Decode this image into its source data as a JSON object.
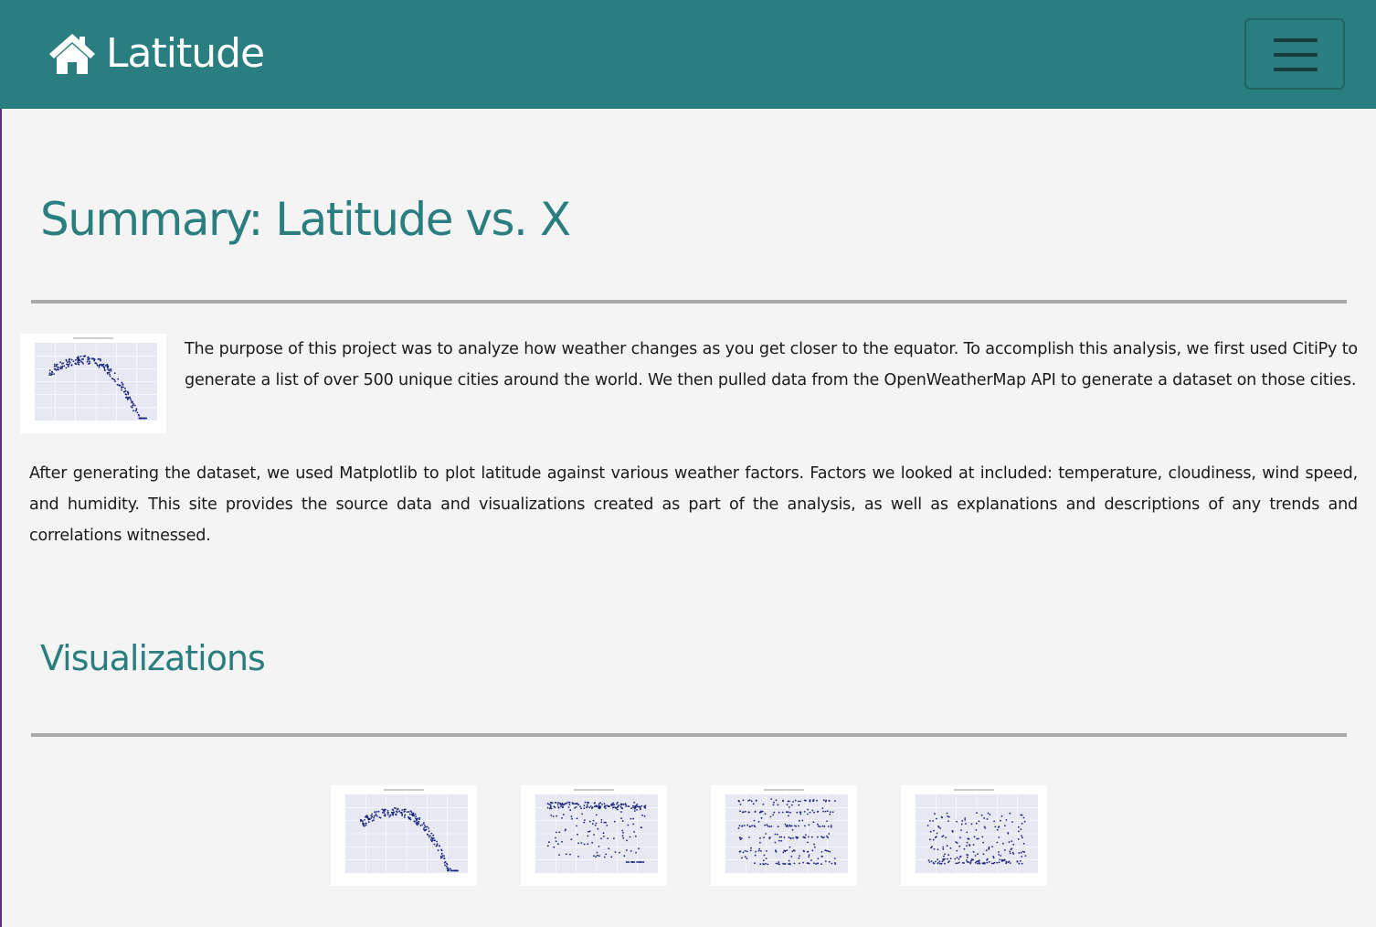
{
  "navbar": {
    "brand_icon": "home-icon",
    "brand_text": "Latitude",
    "menu_icon": "hamburger-menu-icon",
    "background_color": "#2b7e7f"
  },
  "main": {
    "title": "Summary: Latitude vs. X",
    "intro_paragraph": "The purpose of this project was to analyze how weather changes as you get closer to the equator. To accomplish this analysis, we first used CitiPy to generate a list of over 500 unique cities around the world. We then pulled data from the OpenWeatherMap API to generate a dataset on those cities.",
    "second_paragraph": "After generating the dataset, we used Matplotlib to plot latitude against various weather factors. Factors we looked at included: temperature, cloudiness, wind speed, and humidity. This site provides the source data and visualizations created as part of the analysis, as well as explanations and descriptions of any trends and correlations witnessed.",
    "visualizations_heading": "Visualizations"
  },
  "thumbnails": [
    {
      "kind": "temperature-scatter-thumbnail"
    },
    {
      "kind": "humidity-scatter-thumbnail"
    },
    {
      "kind": "cloudiness-scatter-thumbnail"
    },
    {
      "kind": "wind-speed-scatter-thumbnail"
    }
  ],
  "colors": {
    "accent": "#2b7e7f",
    "rule": "#a9a9a9",
    "background": "#f4f4f4",
    "plot_point": "#1a237e"
  }
}
